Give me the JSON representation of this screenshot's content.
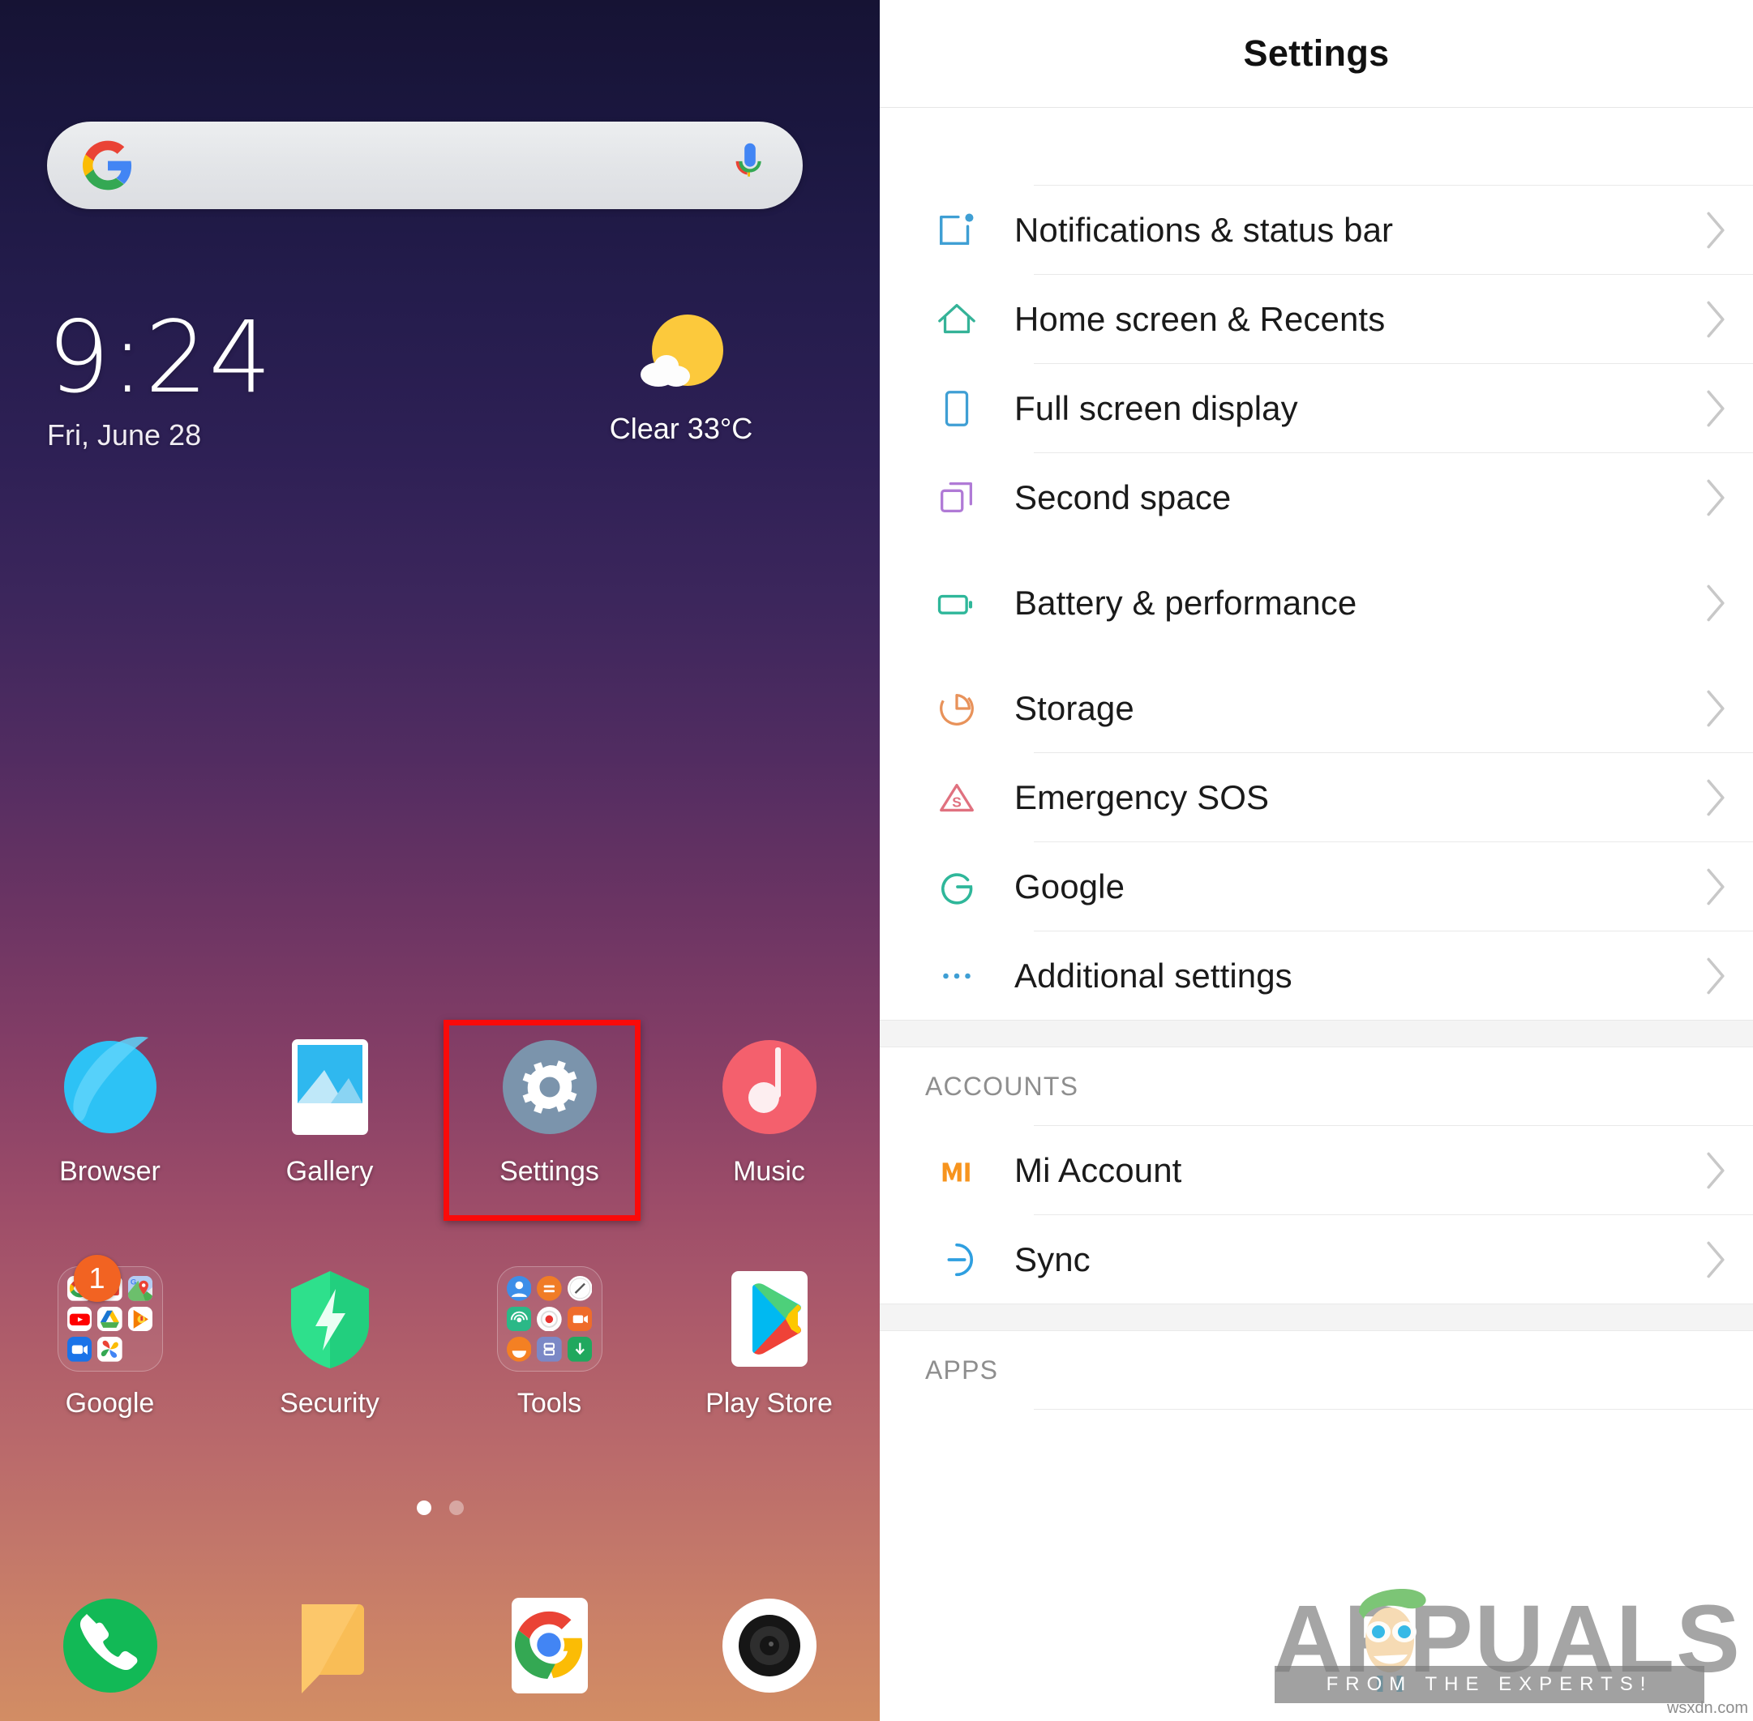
{
  "home": {
    "search": {
      "placeholder": "",
      "google_icon": "google-g-logo",
      "mic_icon": "microphone-icon"
    },
    "clock": {
      "time": "9:24",
      "date": "Fri, June 28"
    },
    "weather": {
      "condition": "Clear",
      "temperature": "33°C",
      "icon": "sun-behind-cloud-icon",
      "text": "Clear  33°C"
    },
    "rows": [
      {
        "apps": [
          {
            "label": "Browser",
            "icon": "browser-icon"
          },
          {
            "label": "Gallery",
            "icon": "gallery-icon"
          },
          {
            "label": "Settings",
            "icon": "settings-gear-icon",
            "highlighted": true
          },
          {
            "label": "Music",
            "icon": "music-note-icon"
          }
        ]
      },
      {
        "apps": [
          {
            "label": "Google",
            "icon": "google-folder-icon",
            "badge": "1"
          },
          {
            "label": "Security",
            "icon": "security-shield-icon"
          },
          {
            "label": "Tools",
            "icon": "tools-folder-icon"
          },
          {
            "label": "Play Store",
            "icon": "play-store-icon"
          }
        ]
      }
    ],
    "page_indicator": {
      "total": 2,
      "active": 1
    },
    "dock": [
      {
        "label": "Phone",
        "icon": "phone-handset-icon"
      },
      {
        "label": "Messaging",
        "icon": "message-bubble-icon"
      },
      {
        "label": "Chrome",
        "icon": "chrome-icon"
      },
      {
        "label": "Camera",
        "icon": "camera-lens-icon"
      }
    ]
  },
  "settings": {
    "title": "Settings",
    "items": [
      {
        "label": "Notifications & status bar",
        "icon": "notification-badge-icon",
        "color": "#3f9fd4"
      },
      {
        "label": "Home screen & Recents",
        "icon": "home-outline-icon",
        "color": "#35b398"
      },
      {
        "label": "Full screen display",
        "icon": "phone-outline-icon",
        "color": "#3f9fd4"
      },
      {
        "label": "Second space",
        "icon": "two-squares-icon",
        "color": "#b07ad6"
      },
      {
        "label": "Battery & performance",
        "icon": "battery-icon",
        "color": "#2fb79a",
        "highlighted": true
      },
      {
        "label": "Storage",
        "icon": "pie-chart-icon",
        "color": "#e8925a"
      },
      {
        "label": "Emergency SOS",
        "icon": "sos-triangle-icon",
        "color": "#e0717f"
      },
      {
        "label": "Google",
        "icon": "google-g-outline-icon",
        "color": "#2fb79a"
      },
      {
        "label": "Additional settings",
        "icon": "ellipsis-icon",
        "color": "#3f9fd4"
      }
    ],
    "sections": [
      {
        "header": "ACCOUNTS",
        "items": [
          {
            "label": "Mi Account",
            "icon": "mi-logo-icon",
            "color": "#f7941e"
          },
          {
            "label": "Sync",
            "icon": "sync-circle-icon",
            "color": "#2f9fe0"
          }
        ]
      },
      {
        "header": "APPS",
        "items": []
      }
    ],
    "chevron_icon": "chevron-right-icon"
  },
  "annotations": {
    "highlight_color": "#fa0a0a",
    "boxes": [
      {
        "target": "settings-app-icon"
      },
      {
        "target": "battery-and-performance-row"
      }
    ]
  },
  "watermark": {
    "brand": "APPUALS",
    "tagline": "FROM THE EXPERTS!",
    "host": "wsxdn.com"
  }
}
